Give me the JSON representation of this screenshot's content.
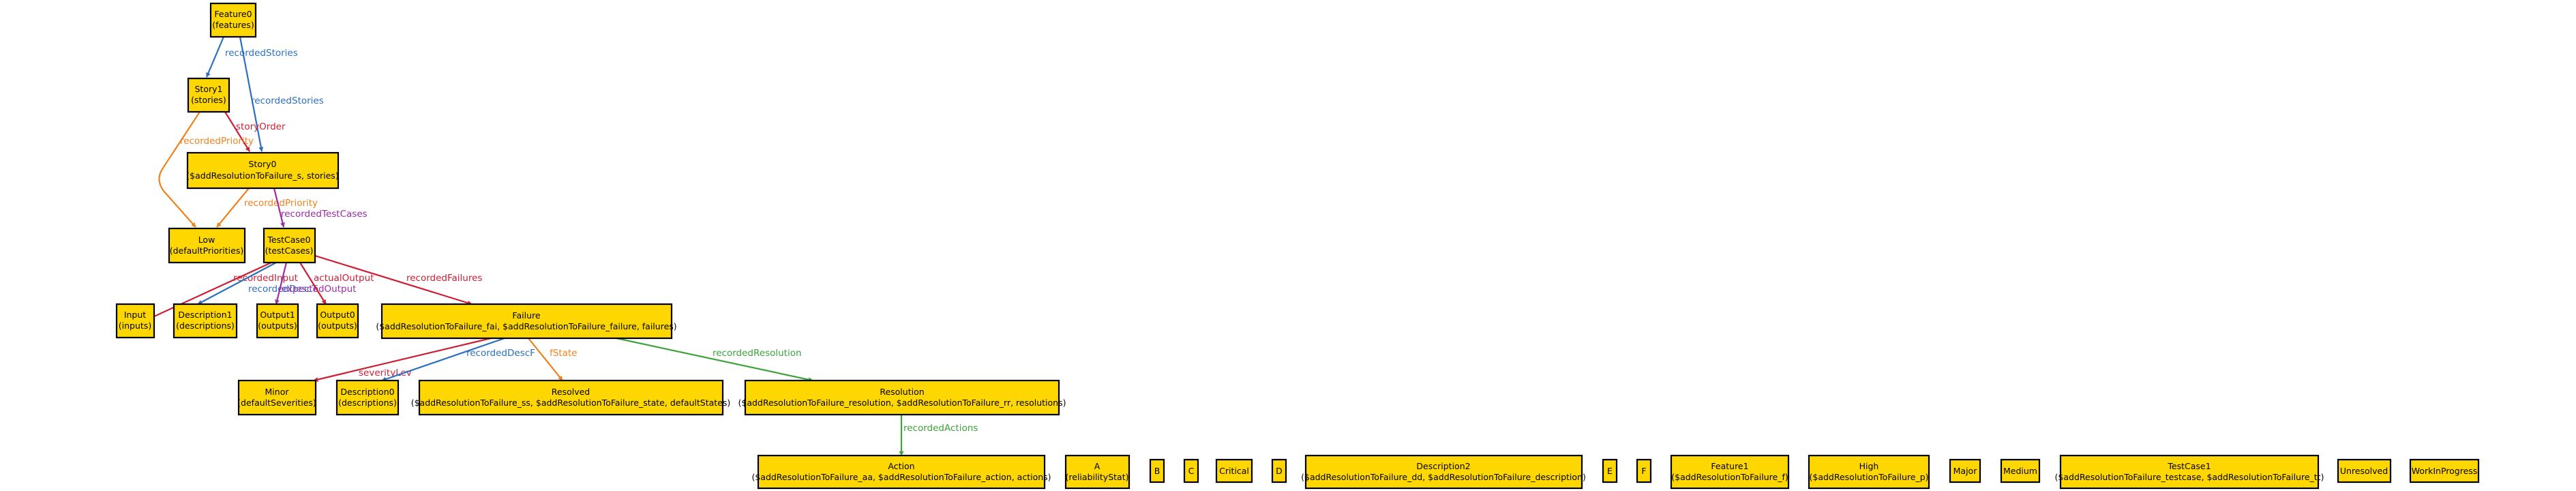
{
  "colors": {
    "node_fill": "#ffd700",
    "node_border": "#000000",
    "background": "#ffffff",
    "blue": "#2c6fbf",
    "orange": "#f0821e",
    "purple": "#9a2da6",
    "red": "#cd1f35",
    "green": "#3ea23a"
  },
  "nodes": {
    "feature0": {
      "line1": "Feature0",
      "line2": "(features)"
    },
    "story1": {
      "line1": "Story1",
      "line2": "(stories)"
    },
    "story0": {
      "line1": "Story0",
      "line2": "($addResolutionToFailure_s, stories)"
    },
    "low": {
      "line1": "Low",
      "line2": "(defaultPriorities)"
    },
    "testcase0": {
      "line1": "TestCase0",
      "line2": "(testCases)"
    },
    "input": {
      "line1": "Input",
      "line2": "(inputs)"
    },
    "description1": {
      "line1": "Description1",
      "line2": "(descriptions)"
    },
    "output1": {
      "line1": "Output1",
      "line2": "(outputs)"
    },
    "output0": {
      "line1": "Output0",
      "line2": "(outputs)"
    },
    "failure": {
      "line1": "Failure",
      "line2": "($addResolutionToFailure_fai, $addResolutionToFailure_failure, failures)"
    },
    "minor": {
      "line1": "Minor",
      "line2": "(defaultSeverities)"
    },
    "description0": {
      "line1": "Description0",
      "line2": "(descriptions)"
    },
    "resolved": {
      "line1": "Resolved",
      "line2": "($addResolutionToFailure_ss, $addResolutionToFailure_state, defaultStates)"
    },
    "resolution": {
      "line1": "Resolution",
      "line2": "($addResolutionToFailure_resolution, $addResolutionToFailure_rr, resolutions)"
    },
    "action": {
      "line1": "Action",
      "line2": "($addResolutionToFailure_aa, $addResolutionToFailure_action, actions)"
    },
    "a": {
      "line1": "A",
      "line2": "(reliabilityStat)"
    },
    "b": {
      "line1": "B"
    },
    "c": {
      "line1": "C"
    },
    "critical": {
      "line1": "Critical"
    },
    "d": {
      "line1": "D"
    },
    "description2": {
      "line1": "Description2",
      "line2": "($addResolutionToFailure_dd, $addResolutionToFailure_description)"
    },
    "e": {
      "line1": "E"
    },
    "f": {
      "line1": "F"
    },
    "feature1": {
      "line1": "Feature1",
      "line2": "($addResolutionToFailure_f)"
    },
    "high": {
      "line1": "High",
      "line2": "($addResolutionToFailure_p)"
    },
    "major": {
      "line1": "Major"
    },
    "medium": {
      "line1": "Medium"
    },
    "testcase1": {
      "line1": "TestCase1",
      "line2": "($addResolutionToFailure_testcase, $addResolutionToFailure_tt)"
    },
    "unresolved": {
      "line1": "Unresolved"
    },
    "workinprogress": {
      "line1": "WorkInProgress"
    }
  },
  "edges": [
    {
      "from": "Feature0",
      "to": "Story1",
      "label": "recordedStories",
      "color": "blue"
    },
    {
      "from": "Feature0",
      "to": "Story0",
      "label": "recordedStories",
      "color": "blue"
    },
    {
      "from": "Story1",
      "to": "Story0",
      "label": "storyOrder",
      "color": "red"
    },
    {
      "from": "Story1",
      "to": "Low",
      "label": "recordedPriority",
      "color": "orange"
    },
    {
      "from": "Story0",
      "to": "Low",
      "label": "recordedPriority",
      "color": "orange"
    },
    {
      "from": "Story0",
      "to": "TestCase0",
      "label": "recordedTestCases",
      "color": "purple"
    },
    {
      "from": "TestCase0",
      "to": "Input",
      "label": "recordedInput",
      "color": "red"
    },
    {
      "from": "TestCase0",
      "to": "Description1",
      "label": "recordedDescT",
      "color": "blue"
    },
    {
      "from": "TestCase0",
      "to": "Output1",
      "label": "expectedOutput",
      "color": "purple"
    },
    {
      "from": "TestCase0",
      "to": "Output0",
      "label": "actualOutput",
      "color": "red"
    },
    {
      "from": "TestCase0",
      "to": "Failure",
      "label": "recordedFailures",
      "color": "red"
    },
    {
      "from": "Failure",
      "to": "Minor",
      "label": "severityLev",
      "color": "red"
    },
    {
      "from": "Failure",
      "to": "Description0",
      "label": "recordedDescF",
      "color": "blue"
    },
    {
      "from": "Failure",
      "to": "Resolved",
      "label": "fState",
      "color": "orange"
    },
    {
      "from": "Failure",
      "to": "Resolution",
      "label": "recordedResolution",
      "color": "green"
    },
    {
      "from": "Resolution",
      "to": "Action",
      "label": "recordedActions",
      "color": "green"
    }
  ]
}
